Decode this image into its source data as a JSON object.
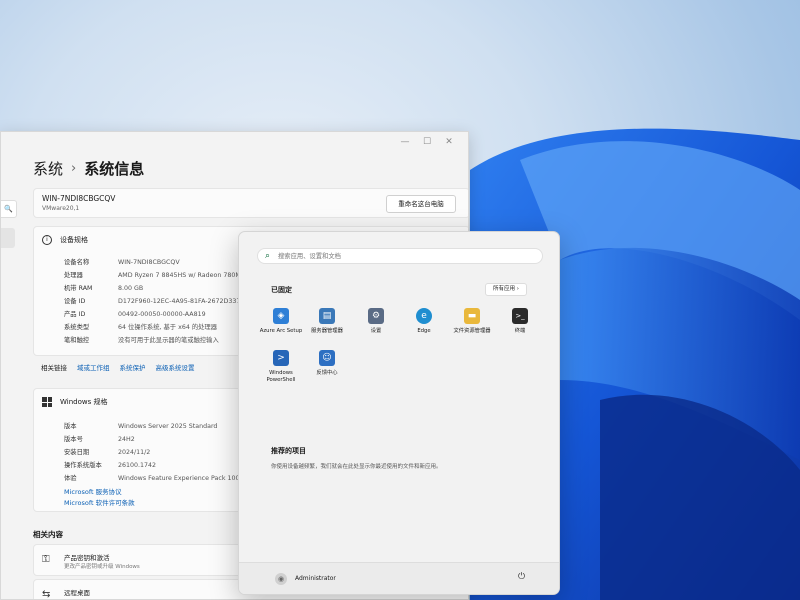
{
  "settings": {
    "window_controls": [
      "—",
      "☐",
      "✕"
    ],
    "side_search_icon": "🔍",
    "breadcrumb": {
      "parent": "系统",
      "separator": "›",
      "current": "系统信息"
    },
    "pc": {
      "name": "WIN-7NDI8CBGCQV",
      "model": "VMware20,1",
      "rename_button": "重命名这台电脑"
    },
    "device_specs": {
      "title": "设备规格",
      "rows": [
        {
          "key": "设备名称",
          "value": "WIN-7NDI8CBGCQV"
        },
        {
          "key": "处理器",
          "value": "AMD Ryzen 7 8845HS w/ Radeon 780M"
        },
        {
          "key": "机带 RAM",
          "value": "8.00 GB"
        },
        {
          "key": "设备 ID",
          "value": "D172F960-12EC-4A95-81FA-2672D337A"
        },
        {
          "key": "产品 ID",
          "value": "00492-00050-00000-AA819"
        },
        {
          "key": "系统类型",
          "value": "64 位操作系统, 基于 x64 的处理器"
        },
        {
          "key": "笔和触控",
          "value": "没有可用于此显示器的笔或触控输入"
        }
      ]
    },
    "related_links": {
      "label": "相关链接",
      "links": [
        "域或工作组",
        "系统保护",
        "高级系统设置"
      ]
    },
    "windows_specs": {
      "title": "Windows 规格",
      "rows": [
        {
          "key": "版本",
          "value": "Windows Server 2025 Standard"
        },
        {
          "key": "版本号",
          "value": "24H2"
        },
        {
          "key": "安装日期",
          "value": "2024/11/2"
        },
        {
          "key": "操作系统版本",
          "value": "26100.1742"
        },
        {
          "key": "体验",
          "value": "Windows Feature Experience Pack 1000.2"
        }
      ],
      "links": [
        "Microsoft 服务协议",
        "Microsoft 软件许可条款"
      ]
    },
    "related": {
      "title": "相关内容",
      "items": [
        {
          "title": "产品密钥和激活",
          "subtitle": "更改产品密钥或升级 Windows"
        },
        {
          "title": "远程桌面",
          "subtitle": ""
        }
      ]
    }
  },
  "start_menu": {
    "search_placeholder": "搜索应用、设置和文档",
    "pinned_title": "已固定",
    "all_apps": "所有应用  ›",
    "apps": [
      {
        "name": "Azure Arc Setup",
        "icon": "azure-arc-icon",
        "glyph": "◈",
        "color": "#2e7fd6"
      },
      {
        "name": "服务器管理器",
        "icon": "server-manager-icon",
        "glyph": "▤",
        "color": "#3a78b8"
      },
      {
        "name": "设置",
        "icon": "settings-icon",
        "glyph": "⚙",
        "color": "#5a6b85"
      },
      {
        "name": "Edge",
        "icon": "edge-icon",
        "glyph": "e",
        "color": "#1f8ed0"
      },
      {
        "name": "文件资源管理器",
        "icon": "folder-icon",
        "glyph": "▬",
        "color": "#e9b83c"
      },
      {
        "name": "终端",
        "icon": "terminal-icon",
        "glyph": ">_",
        "color": "#2b2b2b"
      },
      {
        "name": "Windows PowerShell",
        "icon": "powershell-icon",
        "glyph": ">",
        "color": "#2766b8"
      },
      {
        "name": "反馈中心",
        "icon": "feedback-hub-icon",
        "glyph": "☺",
        "color": "#2d6fc2"
      }
    ],
    "recommended_title": "推荐的项目",
    "recommended_text": "你使用设备越频繁，我们就会在此处显示你最近使用的文件和新应用。",
    "user": "Administrator",
    "power_icon": "⏻"
  }
}
